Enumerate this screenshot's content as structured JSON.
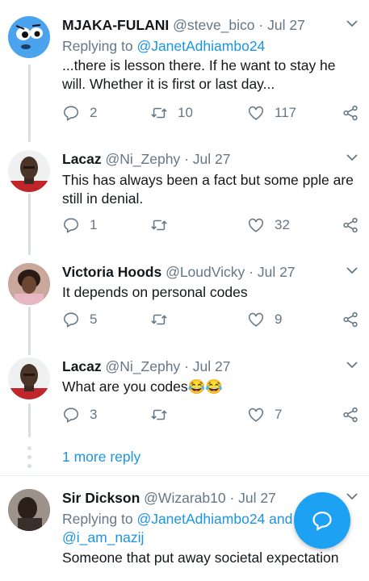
{
  "tweets": [
    {
      "name": "MJAKA-FULANI",
      "handle": "@steve_bico",
      "separator": "·",
      "date": "Jul 27",
      "replying_prefix": "Replying to",
      "replying_to": "@JanetAdhiambo24",
      "text": "...there is lesson there. If he want to stay he will. Whether it is first or last day...",
      "replies": "2",
      "retweets": "10",
      "likes": "117"
    },
    {
      "name": "Lacaz",
      "handle": "@Ni_Zephy",
      "separator": "·",
      "date": "Jul 27",
      "text": "This has always been a fact but some pple are still in denial.",
      "replies": "1",
      "retweets": "",
      "likes": "32"
    },
    {
      "name": "Victoria Hoods",
      "handle": "@LoudVicky",
      "separator": "·",
      "date": "Jul 27",
      "text": "It depends on personal codes",
      "replies": "5",
      "retweets": "",
      "likes": "9"
    },
    {
      "name": "Lacaz",
      "handle": "@Ni_Zephy",
      "separator": "·",
      "date": "Jul 27",
      "text": "What are you codes😂😂",
      "replies": "3",
      "retweets": "",
      "likes": "7"
    },
    {
      "name": "Sir Dickson",
      "handle": "@Wizarab10",
      "separator": "·",
      "date": "Jul 27",
      "replying_prefix": "Replying to",
      "replying_to": "@JanetAdhiambo24",
      "replying_and": "and",
      "replying_to2": "@i_am_nazij",
      "text": "Someone that put away societal expectation"
    }
  ],
  "more_replies": "1 more reply",
  "colors": {
    "accent": "#1b95e0",
    "fab": "#1da1f2",
    "muted": "#657786",
    "thread": "#d8dee3"
  },
  "icons": [
    "reply-icon",
    "retweet-icon",
    "like-icon",
    "share-icon",
    "chevron-down-icon",
    "compose-reply-icon"
  ]
}
